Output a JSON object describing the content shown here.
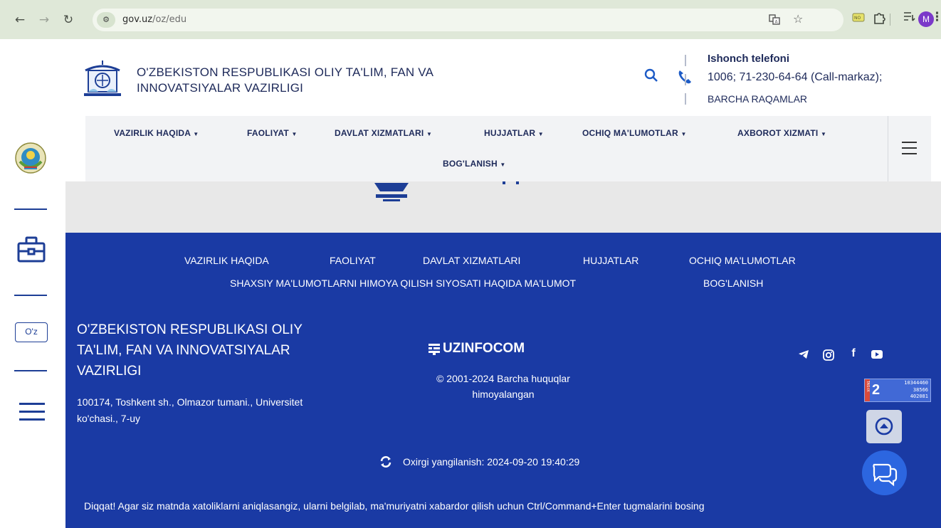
{
  "browser": {
    "url_host": "gov.uz",
    "url_path": "/oz/edu",
    "profile_initial": "M",
    "icons": [
      "back-icon",
      "forward-icon",
      "reload-icon",
      "site-info-icon",
      "translate-icon",
      "star-icon",
      "extension-icon",
      "puzzle-icon",
      "reading-list-icon",
      "menu-dots-icon"
    ]
  },
  "header": {
    "ministry_line1": "O'ZBEKISTON RESPUBLIKASI OLIY TA'LIM, FAN VA",
    "ministry_line2": "INNOVATSIYALAR VAZIRLIGI",
    "hotline_title": "Ishonch telefoni",
    "hotline_numbers": "1006;  71-230-64-64 (Call-markaz);",
    "hotline_all": "BARCHA RAQAMLAR"
  },
  "menu": {
    "items": [
      "VAZIRLIK HAQIDA",
      "FAOLIYAT",
      "DAVLAT XIZMATLARI",
      "HUJJATLAR",
      "OCHIQ MA'LUMOTLAR",
      "AXBOROT XIZMATI",
      "BOG'LANISH"
    ]
  },
  "sidebar": {
    "lang_label": "O'z"
  },
  "footer": {
    "links_row1": [
      "VAZIRLIK HAQIDA",
      "FAOLIYAT",
      "DAVLAT XIZMATLARI",
      "HUJJATLAR",
      "OCHIQ MA'LUMOTLAR"
    ],
    "links_row2": [
      "SHAXSIY MA'LUMOTLARNI HIMOYA QILISH SIYOSATI HAQIDA MA'LUMOT",
      "BOG'LANISH"
    ],
    "ministry_name": "O'ZBEKISTON RESPUBLIKASI OLIY TA'LIM, FAN VA INNOVATSIYALAR VAZIRLIGI",
    "address": "100174, Toshkent sh., Olmazor tumani., Universitet ko'chasi., 7-uy",
    "developer": "UZINFOCOM",
    "copyright": "© 2001-2024 Barcha huquqlar himoyalangan",
    "last_updated": "Oxirgi yangilanish: 2024-09-20 19:40:29",
    "notice": "Diqqat! Agar siz matnda xatoliklarni aniqlasangiz, ularni belgilab, ma'muriyatni xabardor qilish uchun Ctrl/Command+Enter tugmalarini bosing",
    "counter": {
      "brand": "TAS-IX",
      "digit": "2",
      "line1": "10344460",
      "line2": "38566",
      "line3": "402081"
    }
  },
  "colors": {
    "footer_bg": "#1a3aa4",
    "brand_navy": "#1e2a5a",
    "accent_blue": "#1d5bc6"
  }
}
